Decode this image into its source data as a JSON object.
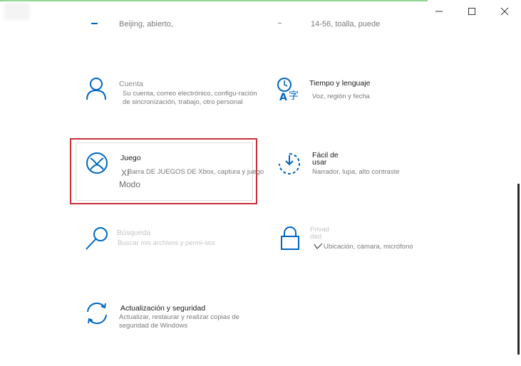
{
  "window": {
    "minimize": "—",
    "maximize": "☐",
    "close": "✕"
  },
  "top_partial": {
    "left_desc": "Beijing, abierto,",
    "right_desc": "14-56, toalla, puede"
  },
  "tiles": {
    "cuenta": {
      "title": "Cuenta",
      "desc": "Su cuenta, correo electrónico, configu-ración de sincronización, trabajo, otro personal"
    },
    "tiempo": {
      "title": "Tiempo y lenguaje",
      "desc": "Voz, región y fecha"
    },
    "juego": {
      "title": "Juego",
      "desc": "Barra DE JUEGOS DE Xbox, captura y juego",
      "x_text": "XI",
      "modo_text": "Modo"
    },
    "facil": {
      "title": "Fácil de usar",
      "desc": "Narrador, lupa, alto contraste"
    },
    "busqueda": {
      "title": "Búsqueda",
      "desc": "Buscar mis archivos y permi-sos"
    },
    "privacidad": {
      "title": "Privad dad",
      "desc": "Ubicación, cámara, micrófono"
    },
    "actualizacion": {
      "title": "Actualización y seguridad",
      "desc": "Actualizar, restaurar y realizar copias de seguridad de Windows"
    }
  },
  "colors": {
    "accent": "#0067c0",
    "selection_border": "#c9303a"
  }
}
